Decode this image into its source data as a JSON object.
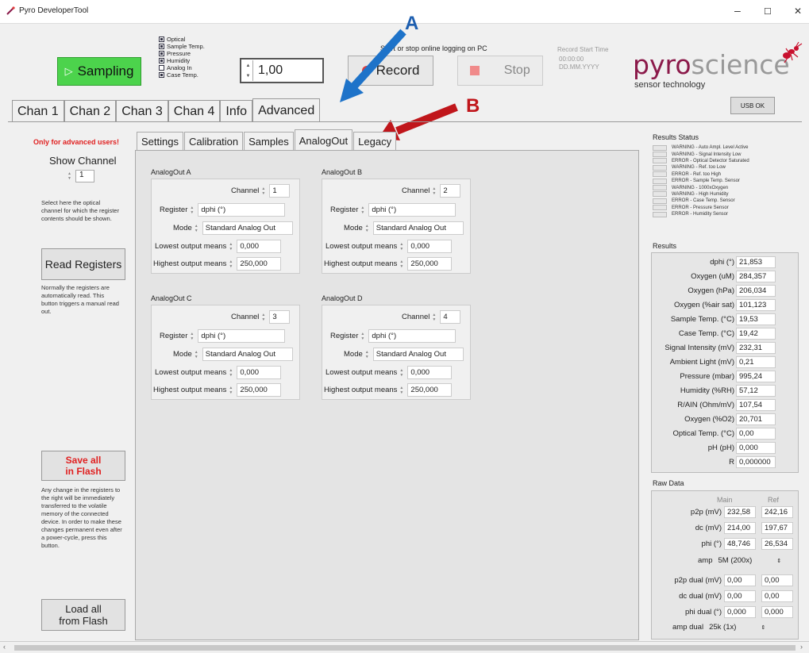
{
  "window": {
    "title": "Pyro DeveloperTool",
    "min": "–",
    "max": "☐",
    "close": "✕"
  },
  "toolbar": {
    "sampling_label": "Sampling",
    "sampling_icon": "▷",
    "checks": [
      {
        "label": "Optical",
        "on": true
      },
      {
        "label": "Sample Temp.",
        "on": true
      },
      {
        "label": "Pressure",
        "on": true
      },
      {
        "label": "Humidity",
        "on": true
      },
      {
        "label": "Analog In",
        "on": false
      },
      {
        "label": "Case Temp.",
        "on": true
      }
    ],
    "interval_value": "1,00",
    "logging_text": "Start or stop online logging on PC",
    "record_label": "Record",
    "stop_label": "Stop",
    "record_start_label": "Record Start Time",
    "record_time": "00:00:00",
    "record_date": "DD.MM.YYYY",
    "logo_main": "pyro",
    "logo_accent": "science",
    "logo_sub": "sensor technology",
    "usb_label": "USB OK"
  },
  "annotations": {
    "a": "A",
    "b": "B"
  },
  "main_tabs": [
    "Chan 1",
    "Chan 2",
    "Chan 3",
    "Chan 4",
    "Info",
    "Advanced"
  ],
  "left": {
    "only_advanced": "Only for advanced users!",
    "show_channel": "Show Channel",
    "channel_value": "1",
    "select_note": "Select here the optical channel for which the register contents should be shown.",
    "read_registers": "Read Registers",
    "read_note": "Normally the registers are automatically read. This button triggers a manual read out.",
    "save_all_1": "Save all",
    "save_all_2": "in Flash",
    "save_note": "Any change in the registers to the right will be immediately transferred to the volatile memory of the connected device. In order to make these changes permanent even after a power-cycle, press this button.",
    "load_all_1": "Load all",
    "load_all_2": "from Flash"
  },
  "sub_tabs": [
    "Settings",
    "Calibration",
    "Samples",
    "AnalogOut",
    "Legacy"
  ],
  "analog_labels": {
    "channel": "Channel",
    "register": "Register",
    "mode": "Mode",
    "lowest": "Lowest output means",
    "highest": "Highest output means"
  },
  "analog_outs": [
    {
      "title": "AnalogOut A",
      "channel": "1",
      "register": "dphi (°)",
      "mode": "Standard Analog Out",
      "lowest": "0,000",
      "highest": "250,000"
    },
    {
      "title": "AnalogOut B",
      "channel": "2",
      "register": "dphi (°)",
      "mode": "Standard Analog Out",
      "lowest": "0,000",
      "highest": "250,000"
    },
    {
      "title": "AnalogOut C",
      "channel": "3",
      "register": "dphi (°)",
      "mode": "Standard Analog Out",
      "lowest": "0,000",
      "highest": "250,000"
    },
    {
      "title": "AnalogOut D",
      "channel": "4",
      "register": "dphi (°)",
      "mode": "Standard Analog Out",
      "lowest": "0,000",
      "highest": "250,000"
    }
  ],
  "results_status": {
    "title": "Results Status",
    "items": [
      "WARNING - Auto Ampl. Level Active",
      "WARNING - Signal Intensity Low",
      "ERROR - Optical Detector Saturated",
      "WARNING - Ref. too Low",
      "ERROR - Ref. too High",
      "ERROR - Sample Temp. Sensor",
      "WARNING - 1000xOxygen",
      "WARNING - High Humidity",
      "ERROR - Case Temp. Sensor",
      "ERROR - Pressure Sensor",
      "ERROR - Humidity Sensor"
    ]
  },
  "results": {
    "title": "Results",
    "rows": [
      {
        "label": "dphi (°)",
        "value": "21,853"
      },
      {
        "label": "Oxygen (uM)",
        "value": "284,357"
      },
      {
        "label": "Oxygen (hPa)",
        "value": "206,034"
      },
      {
        "label": "Oxygen (%air sat)",
        "value": "101,123"
      },
      {
        "label": "Sample Temp. (°C)",
        "value": "19,53"
      },
      {
        "label": "Case Temp. (°C)",
        "value": "19,42"
      },
      {
        "label": "Signal Intensity (mV)",
        "value": "232,31"
      },
      {
        "label": "Ambient Light (mV)",
        "value": "0,21"
      },
      {
        "label": "Pressure (mbar)",
        "value": "995,24"
      },
      {
        "label": "Humidity (%RH)",
        "value": "57,12"
      },
      {
        "label": "R/AIN (Ohm/mV)",
        "value": "107,54"
      },
      {
        "label": "Oxygen (%O2)",
        "value": "20,701"
      },
      {
        "label": "Optical Temp. (°C)",
        "value": "0,00"
      },
      {
        "label": "pH (pH)",
        "value": "0,000"
      },
      {
        "label": "R",
        "value": "0,000000"
      }
    ]
  },
  "raw": {
    "title": "Raw Data",
    "main_header": "Main",
    "ref_header": "Ref",
    "rows": [
      {
        "label": "p2p (mV)",
        "main": "232,58",
        "ref": "242,16"
      },
      {
        "label": "dc (mV)",
        "main": "214,00",
        "ref": "197,67"
      },
      {
        "label": "phi (°)",
        "main": "48,746",
        "ref": "26,534"
      }
    ],
    "amp_label": "amp",
    "amp_value": "5M (200x)",
    "dual_rows": [
      {
        "label": "p2p dual (mV)",
        "main": "0,00",
        "ref": "0,00"
      },
      {
        "label": "dc dual (mV)",
        "main": "0,00",
        "ref": "0,00"
      },
      {
        "label": "phi dual (°)",
        "main": "0,000",
        "ref": "0,000"
      }
    ],
    "amp_dual_label": "amp dual",
    "amp_dual_value": "25k (1x)"
  }
}
